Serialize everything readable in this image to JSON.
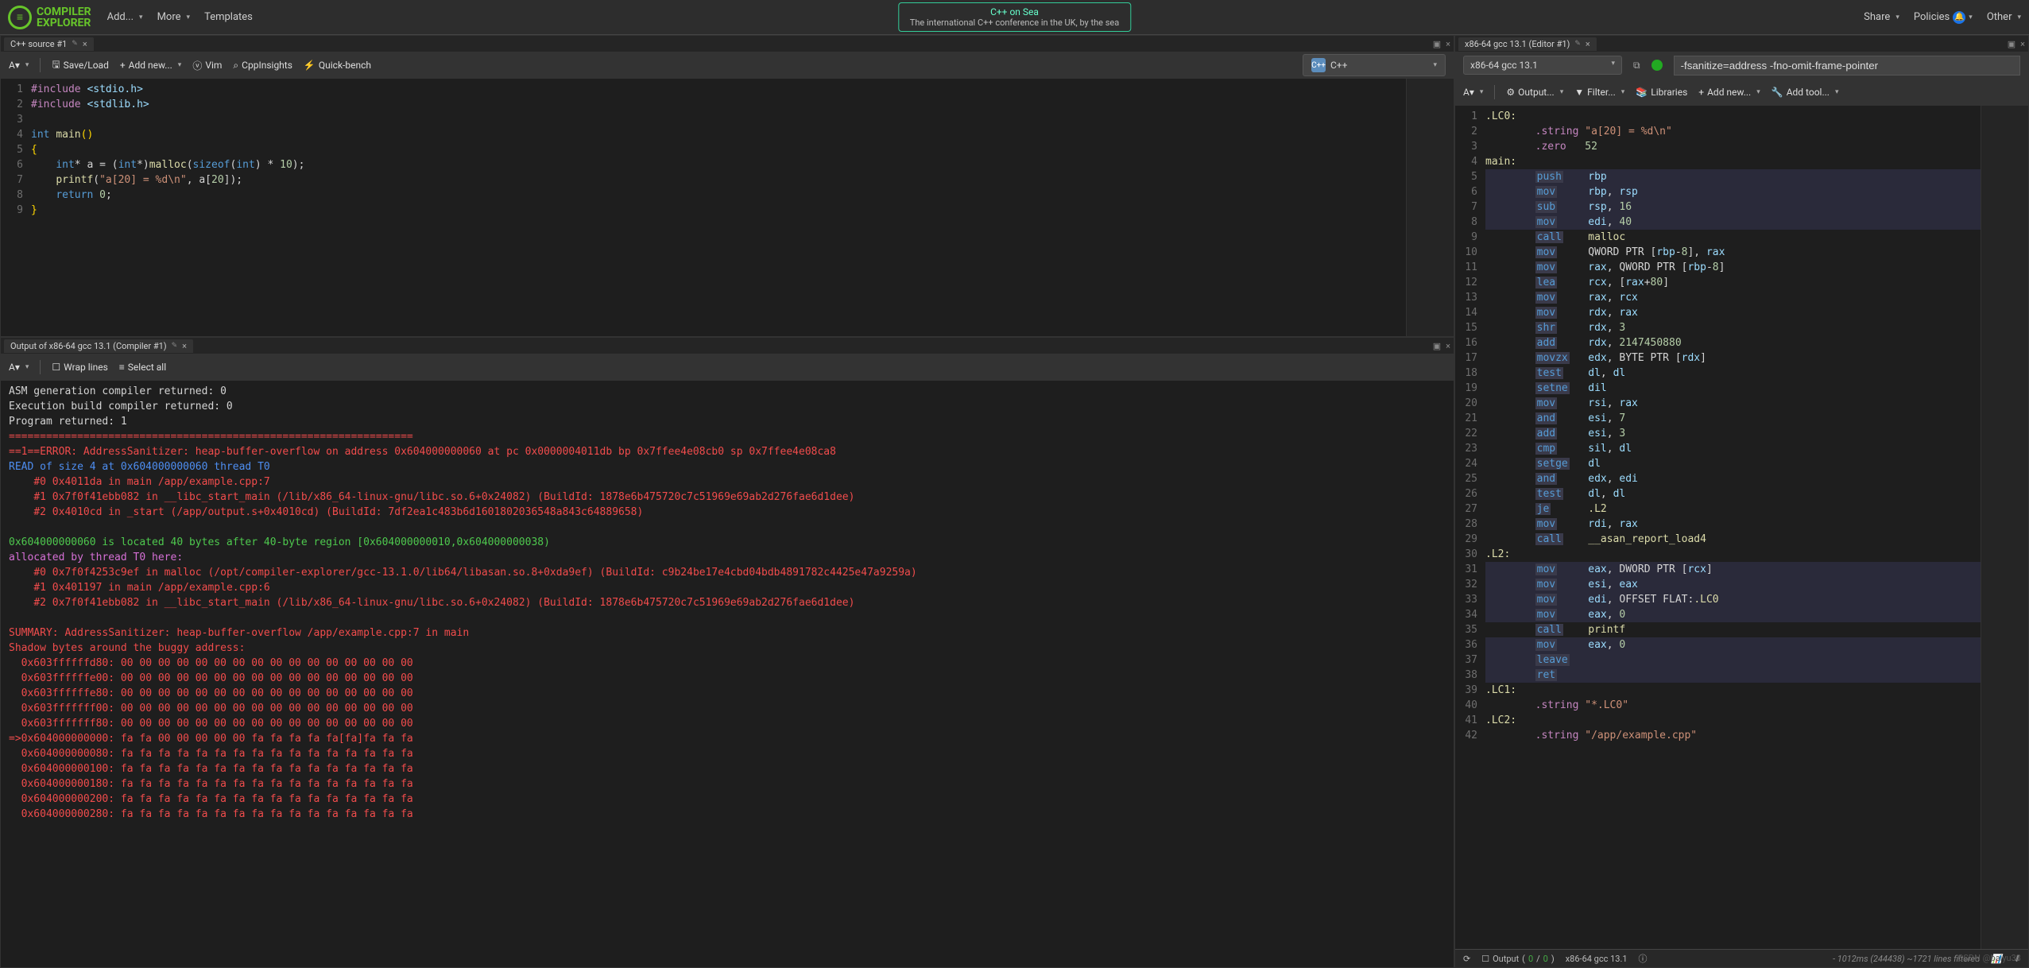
{
  "logo": {
    "text1": "COMPILER",
    "text2": "EXPLORER"
  },
  "nav": {
    "add": "Add...",
    "more": "More",
    "templates": "Templates"
  },
  "banner": {
    "title": "C++ on Sea",
    "sub": "The international C++ conference in the UK, by the sea"
  },
  "rightNav": {
    "share": "Share",
    "policies": "Policies",
    "other": "Other"
  },
  "source": {
    "tab": "C++ source #1",
    "toolbar": {
      "saveLoad": "Save/Load",
      "addNew": "Add new...",
      "vim": "Vim",
      "cppinsights": "CppInsights",
      "quickbench": "Quick-bench"
    },
    "lang": "C++",
    "lines": [
      {
        "n": 1,
        "html": "<span class='pp'>#include</span> <span class='inc'>&lt;stdio.h&gt;</span>"
      },
      {
        "n": 2,
        "html": "<span class='pp'>#include</span> <span class='inc'>&lt;stdlib.h&gt;</span>"
      },
      {
        "n": 3,
        "html": ""
      },
      {
        "n": 4,
        "html": "<span class='kw'>int</span> <span class='fn'>main</span><span class='punc'>()</span>"
      },
      {
        "n": 5,
        "html": "<span class='punc'>{</span>"
      },
      {
        "n": 6,
        "html": "    <span class='kw'>int</span>* a = (<span class='kw'>int</span>*)<span class='fn'>malloc</span>(<span class='kw'>sizeof</span>(<span class='kw'>int</span>) * <span class='num'>10</span>);"
      },
      {
        "n": 7,
        "html": "    <span class='fn'>printf</span>(<span class='str'>\"a[20] = %d\\n\"</span>, a[<span class='num'>20</span>]);"
      },
      {
        "n": 8,
        "html": "    <span class='kw'>return</span> <span class='num'>0</span>;"
      },
      {
        "n": 9,
        "html": "<span class='punc'>}</span>"
      }
    ]
  },
  "output": {
    "tab": "Output of x86-64 gcc 13.1 (Compiler #1)",
    "toolbar": {
      "wrap": "Wrap lines",
      "selectAll": "Select all"
    },
    "lines": [
      {
        "cls": "",
        "text": "ASM generation compiler returned: 0"
      },
      {
        "cls": "",
        "text": "Execution build compiler returned: 0"
      },
      {
        "cls": "",
        "text": "Program returned: 1"
      },
      {
        "cls": "out-red",
        "text": "================================================================="
      },
      {
        "cls": "out-red",
        "text": "==1==ERROR: AddressSanitizer: heap-buffer-overflow on address 0x604000000060 at pc 0x0000004011db bp 0x7ffee4e08cb0 sp 0x7ffee4e08ca8"
      },
      {
        "cls": "out-blue",
        "text": "READ of size 4 at 0x604000000060 thread T0"
      },
      {
        "cls": "out-red",
        "text": "    #0 0x4011da in main /app/example.cpp:7"
      },
      {
        "cls": "out-red",
        "text": "    #1 0x7f0f41ebb082 in __libc_start_main (/lib/x86_64-linux-gnu/libc.so.6+0x24082) (BuildId: 1878e6b475720c7c51969e69ab2d276fae6d1dee)"
      },
      {
        "cls": "out-red",
        "text": "    #2 0x4010cd in _start (/app/output.s+0x4010cd) (BuildId: 7df2ea1c483b6d1601802036548a843c64889658)"
      },
      {
        "cls": "",
        "text": ""
      },
      {
        "cls": "out-green",
        "text": "0x604000000060 is located 40 bytes after 40-byte region [0x604000000010,0x604000000038)"
      },
      {
        "cls": "out-magenta",
        "text": "allocated by thread T0 here:"
      },
      {
        "cls": "out-red",
        "text": "    #0 0x7f0f4253c9ef in malloc (/opt/compiler-explorer/gcc-13.1.0/lib64/libasan.so.8+0xda9ef) (BuildId: c9b24be17e4cbd04bdb4891782c4425e47a9259a)"
      },
      {
        "cls": "out-red",
        "text": "    #1 0x401197 in main /app/example.cpp:6"
      },
      {
        "cls": "out-red",
        "text": "    #2 0x7f0f41ebb082 in __libc_start_main (/lib/x86_64-linux-gnu/libc.so.6+0x24082) (BuildId: 1878e6b475720c7c51969e69ab2d276fae6d1dee)"
      },
      {
        "cls": "",
        "text": ""
      },
      {
        "cls": "out-red",
        "text": "SUMMARY: AddressSanitizer: heap-buffer-overflow /app/example.cpp:7 in main"
      },
      {
        "cls": "out-red",
        "text": "Shadow bytes around the buggy address:"
      },
      {
        "cls": "out-red",
        "text": "  0x603ffffffd80: 00 00 00 00 00 00 00 00 00 00 00 00 00 00 00 00"
      },
      {
        "cls": "out-red",
        "text": "  0x603ffffffe00: 00 00 00 00 00 00 00 00 00 00 00 00 00 00 00 00"
      },
      {
        "cls": "out-red",
        "text": "  0x603ffffffe80: 00 00 00 00 00 00 00 00 00 00 00 00 00 00 00 00"
      },
      {
        "cls": "out-red",
        "text": "  0x603fffffff00: 00 00 00 00 00 00 00 00 00 00 00 00 00 00 00 00"
      },
      {
        "cls": "out-red",
        "text": "  0x603fffffff80: 00 00 00 00 00 00 00 00 00 00 00 00 00 00 00 00"
      },
      {
        "cls": "out-red",
        "text": "=>0x604000000000: fa fa 00 00 00 00 00 fa fa fa fa fa[fa]fa fa fa"
      },
      {
        "cls": "out-red",
        "text": "  0x604000000080: fa fa fa fa fa fa fa fa fa fa fa fa fa fa fa fa"
      },
      {
        "cls": "out-red",
        "text": "  0x604000000100: fa fa fa fa fa fa fa fa fa fa fa fa fa fa fa fa"
      },
      {
        "cls": "out-red",
        "text": "  0x604000000180: fa fa fa fa fa fa fa fa fa fa fa fa fa fa fa fa"
      },
      {
        "cls": "out-red",
        "text": "  0x604000000200: fa fa fa fa fa fa fa fa fa fa fa fa fa fa fa fa"
      },
      {
        "cls": "out-red",
        "text": "  0x604000000280: fa fa fa fa fa fa fa fa fa fa fa fa fa fa fa fa"
      }
    ]
  },
  "asm": {
    "tab": "x86-64 gcc 13.1 (Editor #1)",
    "compiler": "x86-64 gcc 13.1",
    "options": "-fsanitize=address -fno-omit-frame-pointer",
    "toolbar": {
      "output": "Output...",
      "filter": "Filter...",
      "libraries": "Libraries",
      "addNew": "Add new...",
      "addTool": "Add tool..."
    },
    "lines": [
      {
        "n": 1,
        "html": "<span class='label'>.LC0:</span>"
      },
      {
        "n": 2,
        "html": "        <span class='asm-dir'>.string</span> <span class='str'>\"a[20] = %d\\n\"</span>"
      },
      {
        "n": 3,
        "html": "        <span class='asm-dir'>.zero</span>   <span class='num'>52</span>"
      },
      {
        "n": 4,
        "html": "<span class='label'>main:</span>"
      },
      {
        "n": 5,
        "hl": true,
        "html": "        <span class='asm-kw'>push</span>    <span class='reg'>rbp</span>"
      },
      {
        "n": 6,
        "hl": true,
        "html": "        <span class='asm-kw'>mov</span>     <span class='reg'>rbp</span>, <span class='reg'>rsp</span>"
      },
      {
        "n": 7,
        "hl": true,
        "html": "        <span class='asm-kw'>sub</span>     <span class='reg'>rsp</span>, <span class='num'>16</span>"
      },
      {
        "n": 8,
        "hl": true,
        "html": "        <span class='asm-kw'>mov</span>     <span class='reg'>edi</span>, <span class='num'>40</span>"
      },
      {
        "n": 9,
        "html": "        <span class='asm-kw'>call</span>    <span class='fn'>malloc</span>"
      },
      {
        "n": 10,
        "html": "        <span class='asm-kw'>mov</span>     QWORD PTR [<span class='reg'>rbp</span>-<span class='num'>8</span>], <span class='reg'>rax</span>"
      },
      {
        "n": 11,
        "html": "        <span class='asm-kw'>mov</span>     <span class='reg'>rax</span>, QWORD PTR [<span class='reg'>rbp</span>-<span class='num'>8</span>]"
      },
      {
        "n": 12,
        "html": "        <span class='asm-kw'>lea</span>     <span class='reg'>rcx</span>, [<span class='reg'>rax</span>+<span class='num'>80</span>]"
      },
      {
        "n": 13,
        "html": "        <span class='asm-kw'>mov</span>     <span class='reg'>rax</span>, <span class='reg'>rcx</span>"
      },
      {
        "n": 14,
        "html": "        <span class='asm-kw'>mov</span>     <span class='reg'>rdx</span>, <span class='reg'>rax</span>"
      },
      {
        "n": 15,
        "html": "        <span class='asm-kw'>shr</span>     <span class='reg'>rdx</span>, <span class='num'>3</span>"
      },
      {
        "n": 16,
        "html": "        <span class='asm-kw'>add</span>     <span class='reg'>rdx</span>, <span class='num'>2147450880</span>"
      },
      {
        "n": 17,
        "html": "        <span class='asm-kw'>movzx</span>   <span class='reg'>edx</span>, BYTE PTR [<span class='reg'>rdx</span>]"
      },
      {
        "n": 18,
        "html": "        <span class='asm-kw'>test</span>    <span class='reg'>dl</span>, <span class='reg'>dl</span>"
      },
      {
        "n": 19,
        "html": "        <span class='asm-kw'>setne</span>   <span class='reg'>dil</span>"
      },
      {
        "n": 20,
        "html": "        <span class='asm-kw'>mov</span>     <span class='reg'>rsi</span>, <span class='reg'>rax</span>"
      },
      {
        "n": 21,
        "html": "        <span class='asm-kw'>and</span>     <span class='reg'>esi</span>, <span class='num'>7</span>"
      },
      {
        "n": 22,
        "html": "        <span class='asm-kw'>add</span>     <span class='reg'>esi</span>, <span class='num'>3</span>"
      },
      {
        "n": 23,
        "html": "        <span class='asm-kw'>cmp</span>     <span class='reg'>sil</span>, <span class='reg'>dl</span>"
      },
      {
        "n": 24,
        "html": "        <span class='asm-kw'>setge</span>   <span class='reg'>dl</span>"
      },
      {
        "n": 25,
        "html": "        <span class='asm-kw'>and</span>     <span class='reg'>edx</span>, <span class='reg'>edi</span>"
      },
      {
        "n": 26,
        "html": "        <span class='asm-kw'>test</span>    <span class='reg'>dl</span>, <span class='reg'>dl</span>"
      },
      {
        "n": 27,
        "html": "        <span class='asm-kw'>je</span>      <span class='label'>.L2</span>"
      },
      {
        "n": 28,
        "html": "        <span class='asm-kw'>mov</span>     <span class='reg'>rdi</span>, <span class='reg'>rax</span>"
      },
      {
        "n": 29,
        "html": "        <span class='asm-kw'>call</span>    <span class='fn'>__asan_report_load4</span>"
      },
      {
        "n": 30,
        "html": "<span class='label'>.L2:</span>"
      },
      {
        "n": 31,
        "hl": true,
        "html": "        <span class='asm-kw'>mov</span>     <span class='reg'>eax</span>, DWORD PTR [<span class='reg'>rcx</span>]"
      },
      {
        "n": 32,
        "hl": true,
        "html": "        <span class='asm-kw'>mov</span>     <span class='reg'>esi</span>, <span class='reg'>eax</span>"
      },
      {
        "n": 33,
        "hl": true,
        "html": "        <span class='asm-kw'>mov</span>     <span class='reg'>edi</span>, OFFSET FLAT:<span class='label'>.LC0</span>"
      },
      {
        "n": 34,
        "hl": true,
        "html": "        <span class='asm-kw'>mov</span>     <span class='reg'>eax</span>, <span class='num'>0</span>"
      },
      {
        "n": 35,
        "html": "        <span class='asm-kw'>call</span>    <span class='fn'>printf</span>"
      },
      {
        "n": 36,
        "hl": true,
        "html": "        <span class='asm-kw'>mov</span>     <span class='reg'>eax</span>, <span class='num'>0</span>"
      },
      {
        "n": 37,
        "hl": true,
        "html": "        <span class='asm-kw'>leave</span>"
      },
      {
        "n": 38,
        "hl": true,
        "html": "        <span class='asm-kw'>ret</span>"
      },
      {
        "n": 39,
        "html": "<span class='label'>.LC1:</span>"
      },
      {
        "n": 40,
        "html": "        <span class='asm-dir'>.string</span> <span class='str'>\"*.LC0\"</span>"
      },
      {
        "n": 41,
        "html": "<span class='label'>.LC2:</span>"
      },
      {
        "n": 42,
        "html": "        <span class='asm-dir'>.string</span> <span class='str'>\"/app/example.cpp\"</span>"
      }
    ],
    "status": {
      "output": "Output",
      "zero1": "0",
      "zero2": "0",
      "compiler": "x86-64 gcc 13.1",
      "timing": "- 1012ms (244438) ~1721 lines filtered"
    }
  },
  "watermark": "CSDN @baiyu33"
}
